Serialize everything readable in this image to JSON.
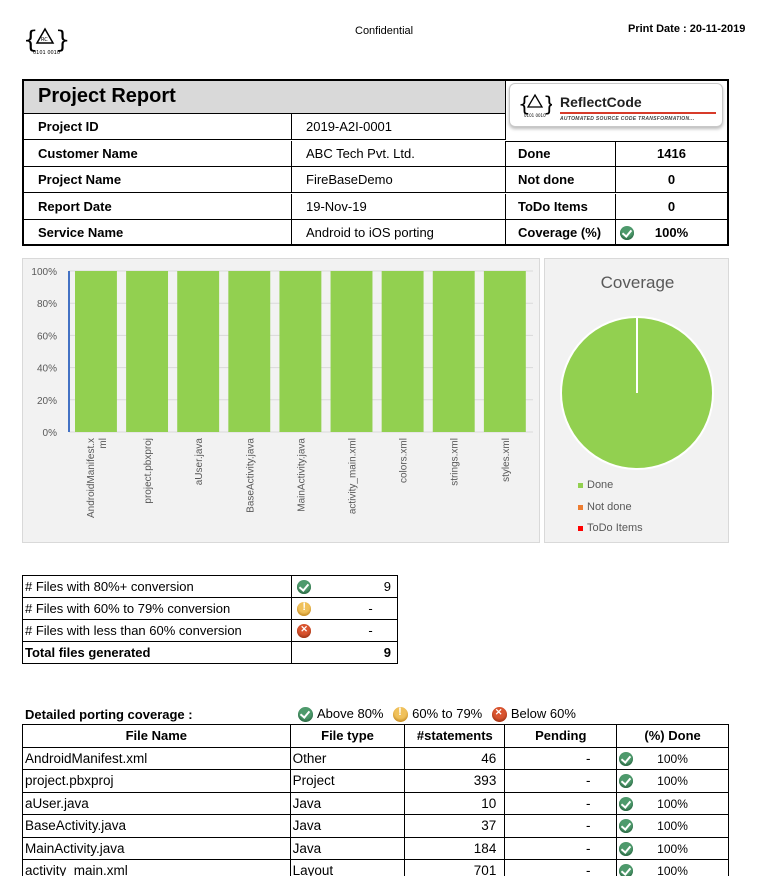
{
  "header": {
    "confidential": "Confidential",
    "print_date_label": "Print Date : 20-11-2019"
  },
  "brand": {
    "name": "ReflectCode",
    "tagline": "AUTOMATED SOURCE CODE TRANSFORMATION..."
  },
  "report": {
    "title": "Project Report",
    "fields": [
      {
        "label": "Project ID",
        "value": "2019-A2I-0001"
      },
      {
        "label": "Customer Name",
        "value": "ABC Tech Pvt. Ltd."
      },
      {
        "label": "Project Name",
        "value": "FireBaseDemo"
      },
      {
        "label": "Report Date",
        "value": "19-Nov-19"
      },
      {
        "label": "Service Name",
        "value": "Android to iOS porting"
      }
    ],
    "stats": [
      {
        "label": "Done",
        "value": "1416"
      },
      {
        "label": "Not done",
        "value": "0"
      },
      {
        "label": "ToDo Items",
        "value": "0"
      },
      {
        "label": "Coverage (%)",
        "value": "100%"
      }
    ]
  },
  "chart_data": [
    {
      "type": "bar",
      "categories": [
        "AndroidManifest.xml",
        "project.pbxproj",
        "aUser.java",
        "BaseActivity.java",
        "MainActivity.java",
        "activity_main.xml",
        "colors.xml",
        "strings.xml",
        "styles.xml"
      ],
      "category_labels": [
        "AndroidManifest.x\nml",
        "project.pbxproj",
        "aUser.java",
        "BaseActivity.java",
        "MainActivity.java",
        "activity_main.xml",
        "colors.xml",
        "strings.xml",
        "styles.xml"
      ],
      "values": [
        100,
        100,
        100,
        100,
        100,
        100,
        100,
        100,
        100
      ],
      "yticks": [
        "100%",
        "80%",
        "60%",
        "40%",
        "20%",
        "0%"
      ],
      "ylim": [
        0,
        100
      ],
      "color": "#92d050",
      "title": ""
    },
    {
      "type": "pie",
      "title": "Coverage",
      "labels": [
        "Done",
        "Not done",
        "ToDo Items"
      ],
      "values": [
        1416,
        0,
        0
      ],
      "colors": [
        "#92d050",
        "#ed7d31",
        "#ff0000"
      ]
    }
  ],
  "summary": [
    {
      "label": "# Files with 80%+ conversion",
      "icon": "check-icon",
      "value": "9"
    },
    {
      "label": "# Files with 60% to 79% conversion",
      "icon": "warning-icon",
      "value": "-"
    },
    {
      "label": "# Files with less than 60% conversion",
      "icon": "cross-icon",
      "value": "-"
    },
    {
      "label": "Total files generated",
      "icon": "",
      "value": "9"
    }
  ],
  "detail": {
    "title": "Detailed porting coverage :",
    "legend": [
      "Above 80%",
      "60% to 79%",
      "Below 60%"
    ],
    "columns": [
      "File Name",
      "File type",
      "#statements",
      "Pending",
      "(%) Done"
    ],
    "rows": [
      [
        "AndroidManifest.xml",
        "Other",
        "46",
        "-",
        "100%"
      ],
      [
        "project.pbxproj",
        "Project",
        "393",
        "-",
        "100%"
      ],
      [
        "aUser.java",
        "Java",
        "10",
        "-",
        "100%"
      ],
      [
        "BaseActivity.java",
        "Java",
        "37",
        "-",
        "100%"
      ],
      [
        "MainActivity.java",
        "Java",
        "184",
        "-",
        "100%"
      ],
      [
        "activity_main.xml",
        "Layout",
        "701",
        "-",
        "100%"
      ]
    ]
  }
}
